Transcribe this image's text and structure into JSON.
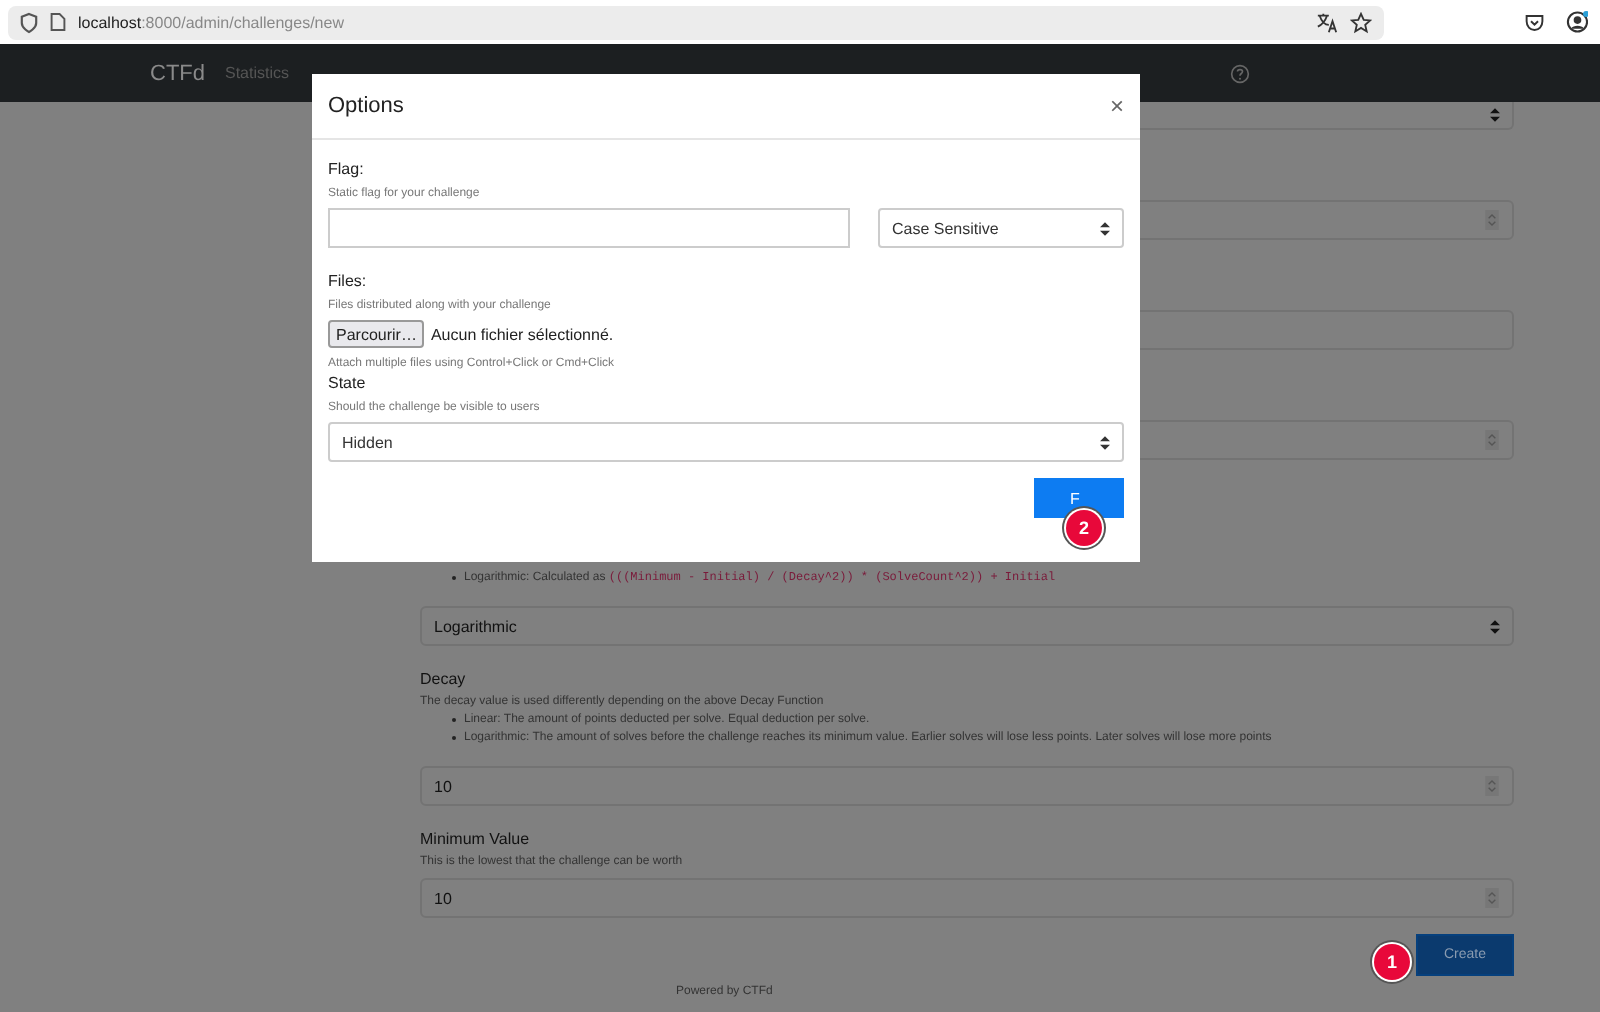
{
  "browser": {
    "url_host": "localhost",
    "url_rest": ":8000/admin/challenges/new"
  },
  "navbar": {
    "brand": "CTFd",
    "items": [
      "Statistics"
    ]
  },
  "top_fields": [
    {
      "kind": "select"
    },
    {
      "kind": "number"
    },
    {
      "kind": "text"
    },
    {
      "kind": "number"
    }
  ],
  "formula_note": {
    "label": "Logarithmic: Calculated as",
    "code": "(((Minimum - Initial) / (Decay^2)) * (SolveCount^2)) + Initial"
  },
  "decay_function": {
    "value": "Logarithmic"
  },
  "decay": {
    "label": "Decay",
    "description": "The decay value is used differently depending on the above Decay Function",
    "bullets": [
      "Linear: The amount of points deducted per solve. Equal deduction per solve.",
      "Logarithmic: The amount of solves before the challenge reaches its minimum value. Earlier solves will lose less points. Later solves will lose more points"
    ],
    "value": "10"
  },
  "minimum": {
    "label": "Minimum Value",
    "description": "This is the lowest that the challenge can be worth",
    "value": "10"
  },
  "create_button": "Create",
  "footer": "Powered by CTFd",
  "modal": {
    "title": "Options",
    "close": "×",
    "flag": {
      "label": "Flag:",
      "hint": "Static flag for your challenge",
      "match": "Case Sensitive"
    },
    "files": {
      "label": "Files:",
      "hint": "Files distributed along with your challenge",
      "browse": "Parcourir…",
      "status": "Aucun fichier sélectionné.",
      "note": "Attach multiple files using Control+Click or Cmd+Click"
    },
    "state": {
      "label": "State",
      "hint": "Should the challenge be visible to users",
      "value": "Hidden"
    },
    "submit": "F"
  },
  "markers": [
    "1",
    "2"
  ]
}
